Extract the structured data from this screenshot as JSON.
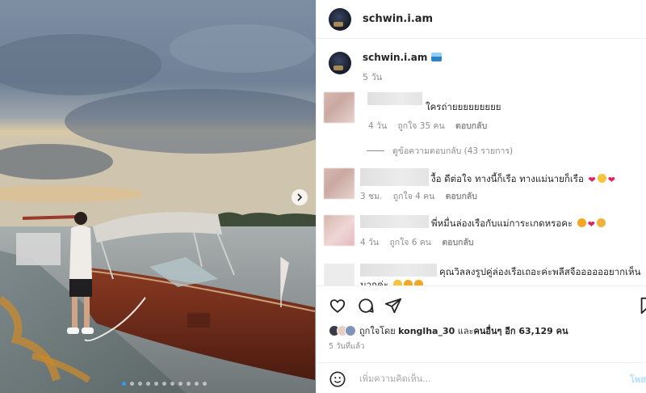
{
  "post": {
    "username": "schwin.i.am",
    "caption_time": "5 วัน",
    "caption_emoji_icon": "boat-sea-emoji"
  },
  "comments": [
    {
      "text": "ใครถ่ายยยยยยยยย",
      "time": "4 วัน",
      "likes": "ถูกใจ 35 คน",
      "reply": "ตอบกลับ",
      "view_replies": "ดูข้อความตอบกลับ (43 รายการ)"
    },
    {
      "text": "งื้อ ดีต่อใจ ทางนี้ก็เรือ ทางแม่นายก็เรือ",
      "emojis": [
        "heart",
        "smiling-face-hearts",
        "heart"
      ],
      "time": "3 ชม.",
      "likes": "ถูกใจ 4 คน",
      "reply": "ตอบกลับ"
    },
    {
      "text": "พี่หมื่นล่องเรือกับแม่การะเกดหรอคะ",
      "emojis": [
        "heart-eyes",
        "heart",
        "clap"
      ],
      "time": "4 วัน",
      "likes": "ถูกใจ 6 คน",
      "reply": "ตอบกลับ"
    },
    {
      "text": "คุณวิลลงรูปคู่ล่องเรือเถอะค่ะพลีสจืออออออยากเห็น",
      "text_line2": "มากค่ะ",
      "emojis": [
        "face",
        "heart-eyes",
        "heart-eyes"
      ]
    }
  ],
  "likes": {
    "prefix": "ถูกใจโดย ",
    "user": "konglha_30",
    "middle": " และ",
    "others": "คนอื่นๆ อีก 63,129 คน"
  },
  "posted_time": "5 วันที่แล้ว",
  "add_comment": {
    "placeholder": "เพิ่มความคิดเห็น...",
    "post_label": "โพส"
  },
  "colors": {
    "accent": "#3897f0",
    "heart": "#e0245e",
    "muted": "#8e8e8e"
  },
  "carousel": {
    "slide_count": 11,
    "current_slide": 1
  }
}
